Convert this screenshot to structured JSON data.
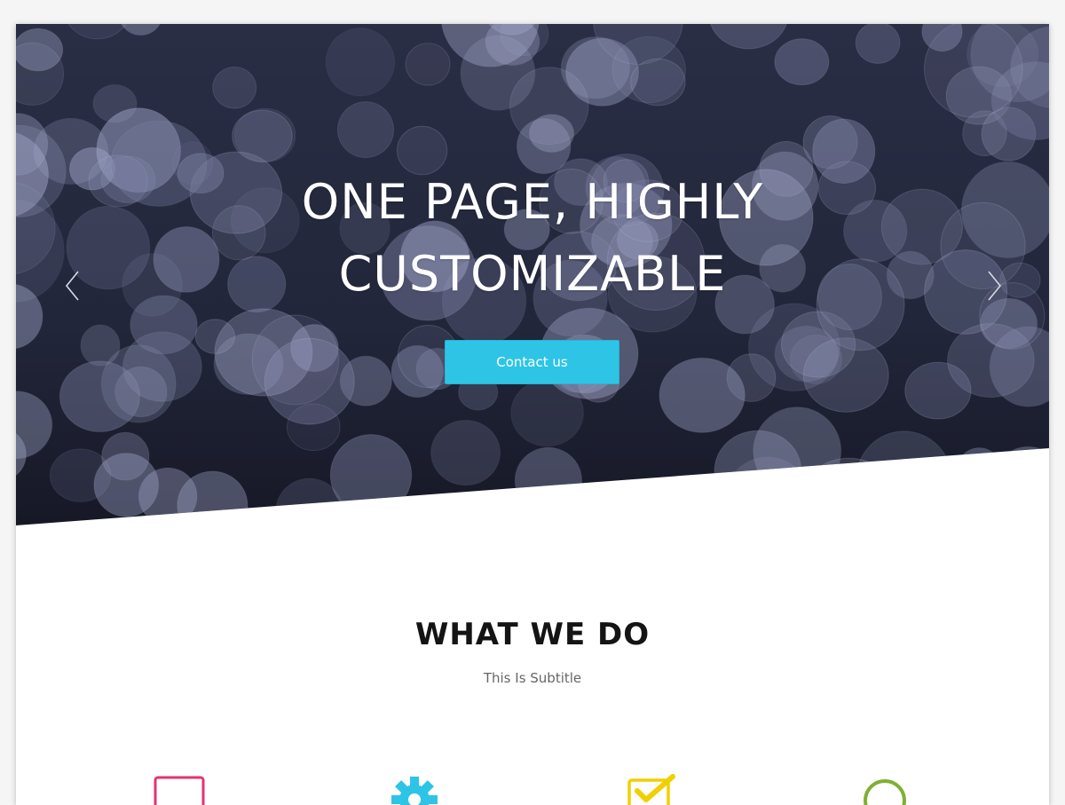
{
  "hero": {
    "title_line1": "ONE PAGE, HIGHLY",
    "title_line2": "CUSTOMIZABLE",
    "button_label": "Contact us",
    "prev_icon": "chevron-left-icon",
    "next_icon": "chevron-right-icon"
  },
  "services": {
    "title": "WHAT WE DO",
    "subtitle": "This Is Subtitle",
    "icons": [
      {
        "name": "square-outline-icon",
        "color": "#e6336e"
      },
      {
        "name": "gear-icon",
        "color": "#2ec4e6"
      },
      {
        "name": "checkbox-icon",
        "color": "#f0d000"
      },
      {
        "name": "circle-outline-icon",
        "color": "#7fb034"
      }
    ]
  },
  "colors": {
    "accent": "#2ec4e6",
    "hero_background": "#1f2236"
  }
}
